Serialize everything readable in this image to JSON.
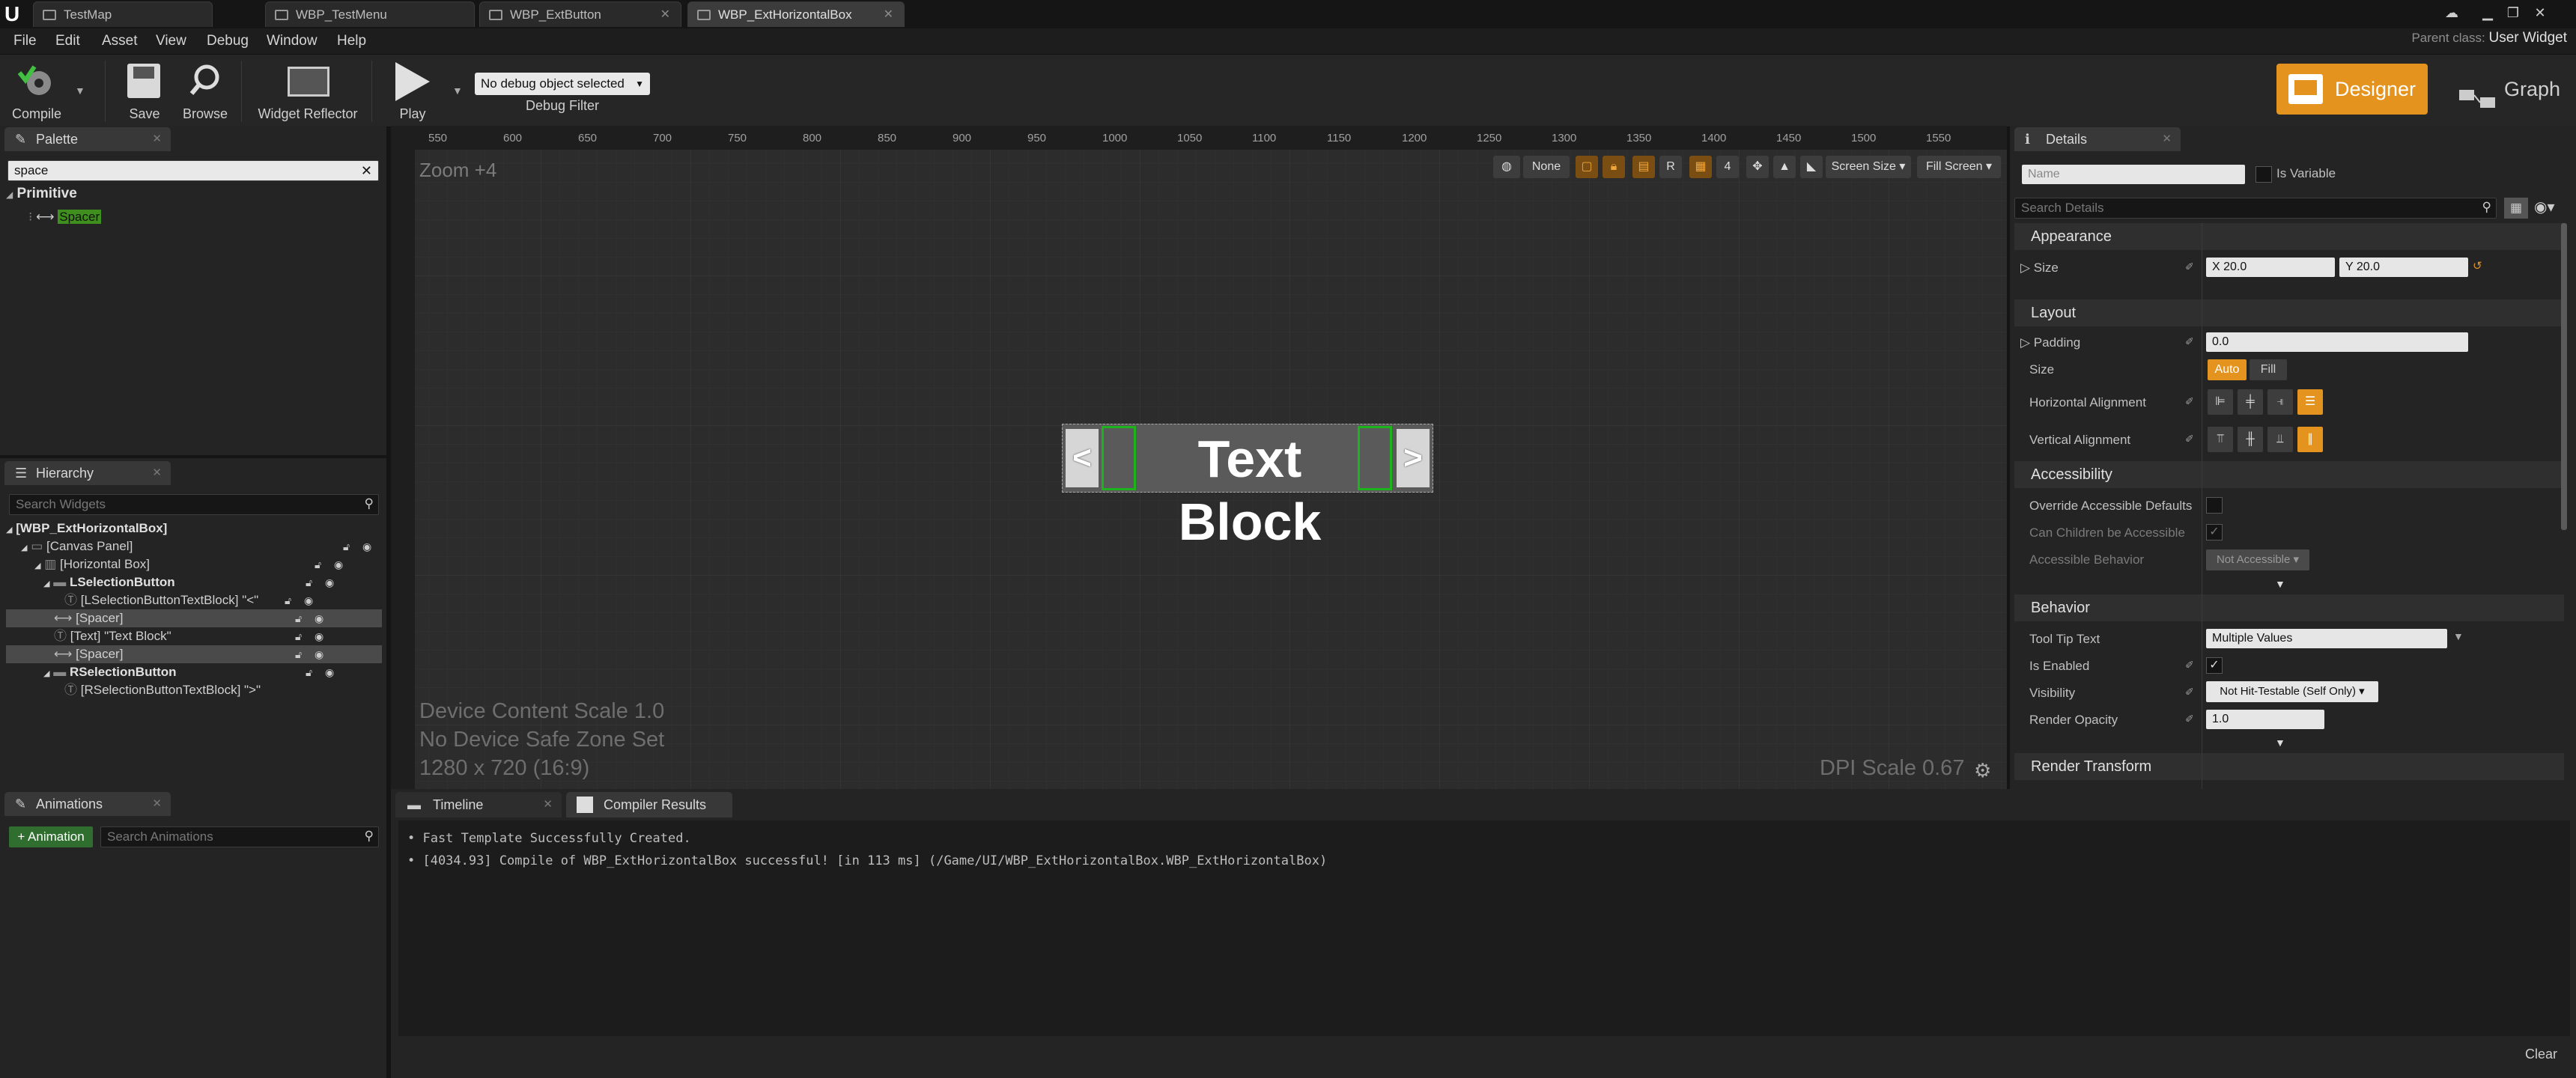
{
  "tabs": [
    {
      "label": "TestMap"
    },
    {
      "label": "WBP_TestMenu"
    },
    {
      "label": "WBP_ExtButton"
    },
    {
      "label": "WBP_ExtHorizontalBox"
    }
  ],
  "parent_class": {
    "prefix": "Parent class:",
    "value": "User Widget"
  },
  "menu": [
    "File",
    "Edit",
    "Asset",
    "View",
    "Debug",
    "Window",
    "Help"
  ],
  "toolbar": {
    "compile": "Compile",
    "save": "Save",
    "browse": "Browse",
    "widget_reflector": "Widget Reflector",
    "play": "Play",
    "debug_object": "No debug object selected",
    "debug_filter": "Debug Filter",
    "designer": "Designer",
    "graph": "Graph"
  },
  "palette": {
    "title": "Palette",
    "search_value": "space",
    "category": "Primitive",
    "item": "Spacer"
  },
  "hierarchy": {
    "title": "Hierarchy",
    "search_placeholder": "Search Widgets",
    "rows": [
      {
        "label": "[WBP_ExtHorizontalBox]",
        "bold": true,
        "selected": false
      },
      {
        "label": "[Canvas Panel]",
        "bold": false,
        "selected": false
      },
      {
        "label": "[Horizontal Box]",
        "bold": false,
        "selected": false
      },
      {
        "label": "LSelectionButton",
        "bold": true,
        "selected": false
      },
      {
        "label": "[LSelectionButtonTextBlock] \"<\"",
        "bold": false,
        "selected": false
      },
      {
        "label": "[Spacer]",
        "bold": false,
        "selected": true
      },
      {
        "label": "[Text] \"Text Block\"",
        "bold": false,
        "selected": false
      },
      {
        "label": "[Spacer]",
        "bold": false,
        "selected": true
      },
      {
        "label": "RSelectionButton",
        "bold": true,
        "selected": false
      },
      {
        "label": "[RSelectionButtonTextBlock] \">\"",
        "bold": false,
        "selected": false
      }
    ]
  },
  "viewport": {
    "zoom": "Zoom +4",
    "ruler_ticks": [
      "550",
      "600",
      "650",
      "700",
      "750",
      "800",
      "850",
      "900",
      "950",
      "1000",
      "1050",
      "1100",
      "1150",
      "1200",
      "1250",
      "1300",
      "1350",
      "1400",
      "1450",
      "1500",
      "1550"
    ],
    "device_scale": "Device Content Scale 1.0",
    "safe_zone": "No Device Safe Zone Set",
    "resolution": "1280 x 720 (16:9)",
    "dpi": "DPI Scale 0.67",
    "tools": {
      "none": "None",
      "r": "R",
      "grid": "4",
      "screen_size": "Screen Size",
      "fill_screen": "Fill Screen"
    },
    "widget": {
      "left": "<",
      "text": "Text Block",
      "right": ">"
    }
  },
  "details": {
    "title": "Details",
    "name_placeholder": "Name",
    "is_variable": "Is Variable",
    "search_placeholder": "Search Details",
    "appearance": "Appearance",
    "size_label": "Size",
    "size_x": "X  20.0",
    "size_y": "Y  20.0",
    "layout": "Layout",
    "padding_label": "Padding",
    "padding_value": "0.0",
    "layout_size_label": "Size",
    "auto": "Auto",
    "fill": "Fill",
    "h_align": "Horizontal Alignment",
    "v_align": "Vertical Alignment",
    "accessibility": "Accessibility",
    "override_acc": "Override Accessible Defaults",
    "can_children": "Can Children be Accessible",
    "acc_behavior": "Accessible Behavior",
    "acc_behavior_value": "Not Accessible",
    "behavior": "Behavior",
    "tooltip_label": "Tool Tip Text",
    "tooltip_value": "Multiple Values",
    "is_enabled": "Is Enabled",
    "visibility_label": "Visibility",
    "visibility_value": "Not Hit-Testable (Self Only)",
    "opacity_label": "Render Opacity",
    "opacity_value": "1.0",
    "render_transform": "Render Transform"
  },
  "animations": {
    "title": "Animations",
    "add_button": "+ Animation",
    "search_placeholder": "Search Animations"
  },
  "bottom_tabs": {
    "timeline": "Timeline",
    "compiler": "Compiler Results"
  },
  "log": [
    "• Fast Template Successfully Created.",
    "• [4034.93] Compile of WBP_ExtHorizontalBox successful! [in 113 ms] (/Game/UI/WBP_ExtHorizontalBox.WBP_ExtHorizontalBox)"
  ],
  "clear": "Clear"
}
